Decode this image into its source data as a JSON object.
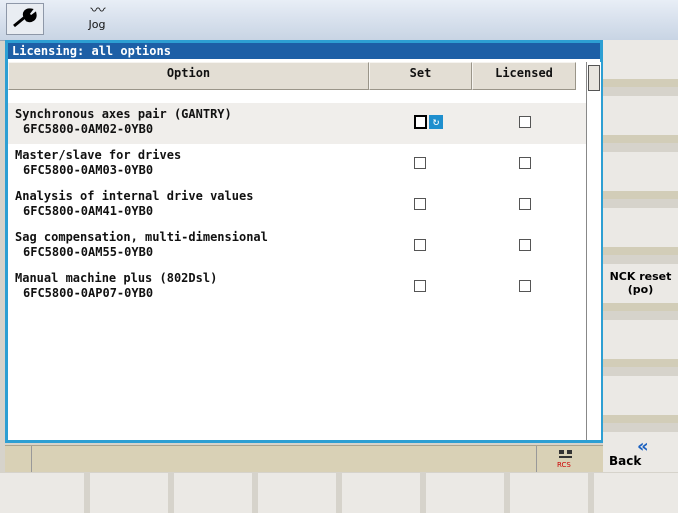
{
  "header": {
    "mode_label": "Jog",
    "tool_icon": "wrench-icon",
    "mode_icon": "jog-wave-icon"
  },
  "dialog": {
    "title": "Licensing: all options",
    "columns": {
      "option": "Option",
      "set": "Set",
      "licensed": "Licensed"
    },
    "options": [
      {
        "name": "Synchronous axes pair (GANTRY)",
        "code": "6FC5800-0AM02-0YB0",
        "set": false,
        "licensed": false
      },
      {
        "name": "Master/slave for drives",
        "code": "6FC5800-0AM03-0YB0",
        "set": false,
        "licensed": false
      },
      {
        "name": "Analysis of internal drive values",
        "code": "6FC5800-0AM41-0YB0",
        "set": false,
        "licensed": false
      },
      {
        "name": "Sag compensation, multi-dimensional",
        "code": "6FC5800-0AM55-0YB0",
        "set": false,
        "licensed": false
      },
      {
        "name": "Manual machine plus (802Dsl)",
        "code": "6FC5800-0AP07-0YB0",
        "set": false,
        "licensed": false
      }
    ]
  },
  "softkeys": {
    "nck_reset": "NCK reset\n(po)",
    "back": "Back",
    "back_icon": "double-chevron-left-icon"
  },
  "status": {
    "rcs_icon": "rcs-network-icon",
    "rcs_label": "RCS"
  },
  "colors": {
    "title_bar": "#1d5fa6",
    "window_border": "#2d9fd3",
    "back_arrow": "#1a60c0"
  }
}
